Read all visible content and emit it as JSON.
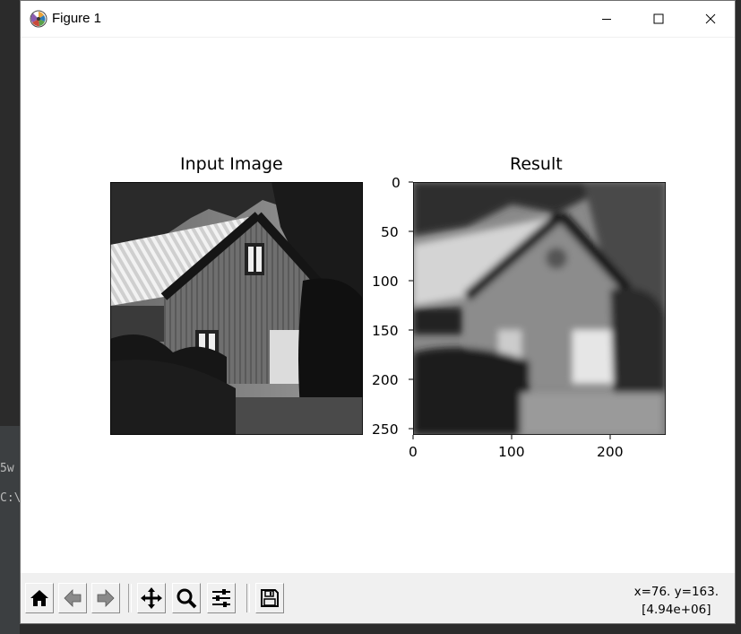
{
  "window": {
    "title": "Figure 1",
    "controls": [
      "minimize",
      "maximize",
      "close"
    ]
  },
  "background": {
    "fragment_1": "5w",
    "fragment_2": "C:\\"
  },
  "figure": {
    "left_title": "Input Image",
    "right_title": "Result",
    "y_ticks": [
      "0",
      "50",
      "100",
      "150",
      "200",
      "250"
    ],
    "x_ticks": [
      "0",
      "100",
      "200"
    ]
  },
  "chart_data": [
    {
      "type": "image",
      "title": "Input Image",
      "axes": "off",
      "content": "grayscale photo of a house"
    },
    {
      "type": "image",
      "title": "Result",
      "content": "filtered (blurred) grayscale house",
      "xlim": [
        0,
        256
      ],
      "ylim": [
        256,
        0
      ],
      "x_ticks": [
        0,
        100,
        200
      ],
      "y_ticks": [
        0,
        50,
        100,
        150,
        200,
        250
      ]
    }
  ],
  "toolbar": {
    "buttons": [
      "home-icon",
      "back-arrow-icon",
      "forward-arrow-icon",
      "pan-icon",
      "zoom-icon",
      "configure-icon",
      "save-icon"
    ],
    "coords_line1": "x=76. y=163.",
    "coords_line2": "[4.94e+06]"
  }
}
